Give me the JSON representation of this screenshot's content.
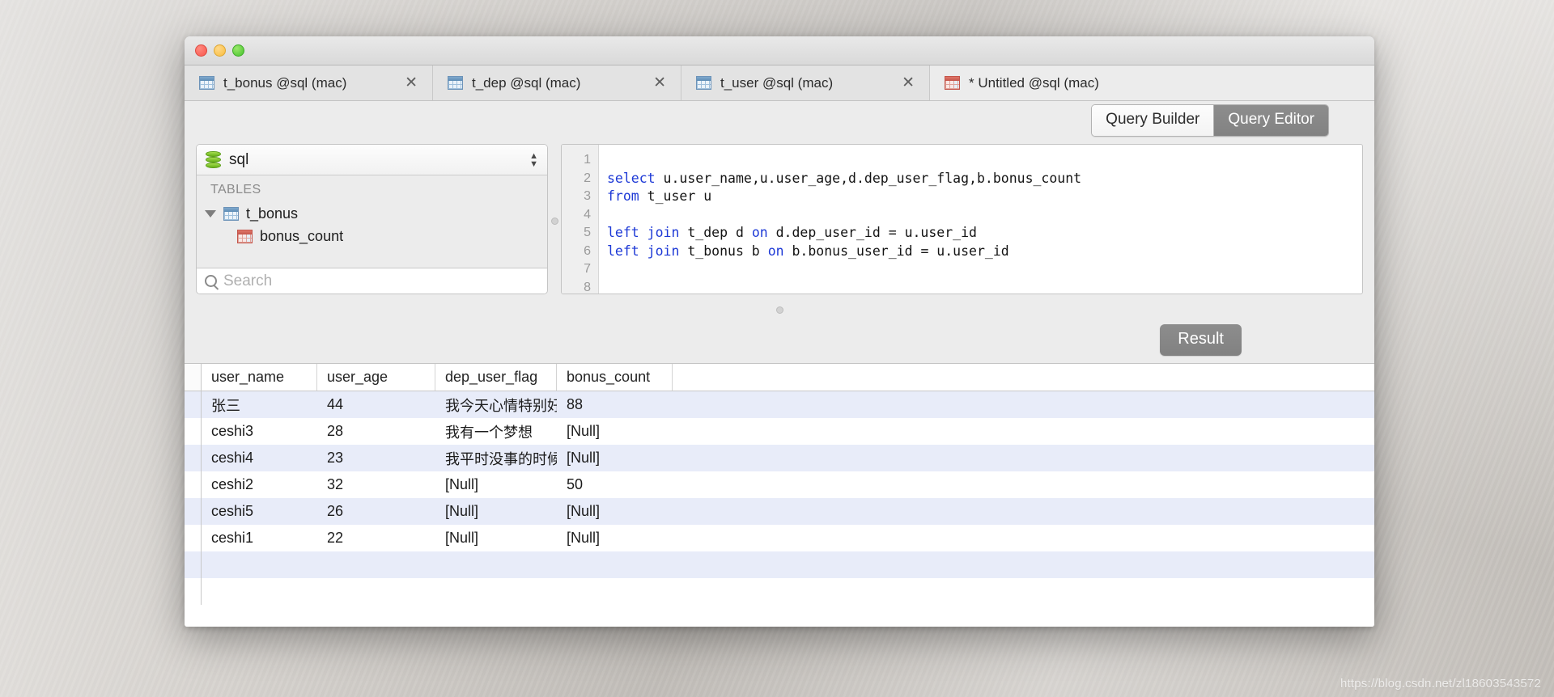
{
  "window": {
    "traffic_lights": [
      "close",
      "minimize",
      "zoom"
    ]
  },
  "tabs": [
    {
      "label": "t_bonus @sql (mac)",
      "icon": "table-icon",
      "active": false,
      "close": "✕"
    },
    {
      "label": "t_dep @sql (mac)",
      "icon": "table-icon",
      "active": false,
      "close": "✕"
    },
    {
      "label": "t_user @sql (mac)",
      "icon": "table-icon",
      "active": false,
      "close": "✕"
    },
    {
      "label": "* Untitled @sql (mac)",
      "icon": "table-icon-red",
      "active": true,
      "close": "✕"
    }
  ],
  "toolbar": {
    "query_builder_label": "Query Builder",
    "query_editor_label": "Query Editor",
    "active_segment": "Query Editor"
  },
  "sidebar": {
    "database": "sql",
    "db_icon": "database-icon",
    "stepper_up": "▲",
    "stepper_down": "▼",
    "section_title": "TABLES",
    "tree": [
      {
        "label": "t_bonus",
        "icon": "table-icon",
        "expanded": true,
        "level": 0
      },
      {
        "label": "bonus_count",
        "icon": "column-icon",
        "expanded": false,
        "level": 1
      }
    ],
    "search_placeholder": "Search",
    "search_value": "",
    "search_icon": "search-icon"
  },
  "editor": {
    "line_numbers": [
      "1",
      "2",
      "3",
      "4",
      "5",
      "6",
      "7",
      "8"
    ],
    "lines": [
      {
        "text": ""
      },
      {
        "segments": [
          {
            "t": "select",
            "kw": true
          },
          {
            "t": " u.user_name,u.user_age,d.dep_user_flag,b.bonus_count",
            "kw": false
          }
        ]
      },
      {
        "segments": [
          {
            "t": "from",
            "kw": true
          },
          {
            "t": " t_user u",
            "kw": false
          }
        ]
      },
      {
        "text": ""
      },
      {
        "segments": [
          {
            "t": "left join",
            "kw": true
          },
          {
            "t": " t_dep d ",
            "kw": false
          },
          {
            "t": "on",
            "kw": true
          },
          {
            "t": " d.dep_user_id = u.user_id",
            "kw": false
          }
        ]
      },
      {
        "segments": [
          {
            "t": "left join",
            "kw": true
          },
          {
            "t": " t_bonus b ",
            "kw": false
          },
          {
            "t": "on",
            "kw": true
          },
          {
            "t": " b.bonus_user_id = u.user_id",
            "kw": false
          }
        ]
      },
      {
        "text": ""
      },
      {
        "text": ""
      }
    ]
  },
  "result_bar": {
    "result_button": "Result",
    "splitter": "splitter-handle"
  },
  "grid": {
    "columns": [
      "user_name",
      "user_age",
      "dep_user_flag",
      "bonus_count"
    ],
    "null_text": "[Null]",
    "rows": [
      {
        "user_name": "张三",
        "user_age": "44",
        "dep_user_flag": "我今天心情特别好，",
        "bonus_count": "88"
      },
      {
        "user_name": "ceshi3",
        "user_age": "28",
        "dep_user_flag": "我有一个梦想",
        "bonus_count": "[Null]"
      },
      {
        "user_name": "ceshi4",
        "user_age": "23",
        "dep_user_flag": "我平时没事的时候喜",
        "bonus_count": "[Null]"
      },
      {
        "user_name": "ceshi2",
        "user_age": "32",
        "dep_user_flag": "[Null]",
        "bonus_count": "50"
      },
      {
        "user_name": "ceshi5",
        "user_age": "26",
        "dep_user_flag": "[Null]",
        "bonus_count": "[Null]"
      },
      {
        "user_name": "ceshi1",
        "user_age": "22",
        "dep_user_flag": "[Null]",
        "bonus_count": "[Null]"
      }
    ]
  },
  "watermark": "https://blog.csdn.net/zl18603543572",
  "colors": {
    "accent_selected": "#828282",
    "row_alt": "#e8ecf9",
    "keyword": "#1d39d6",
    "null": "#b4b4b4"
  }
}
